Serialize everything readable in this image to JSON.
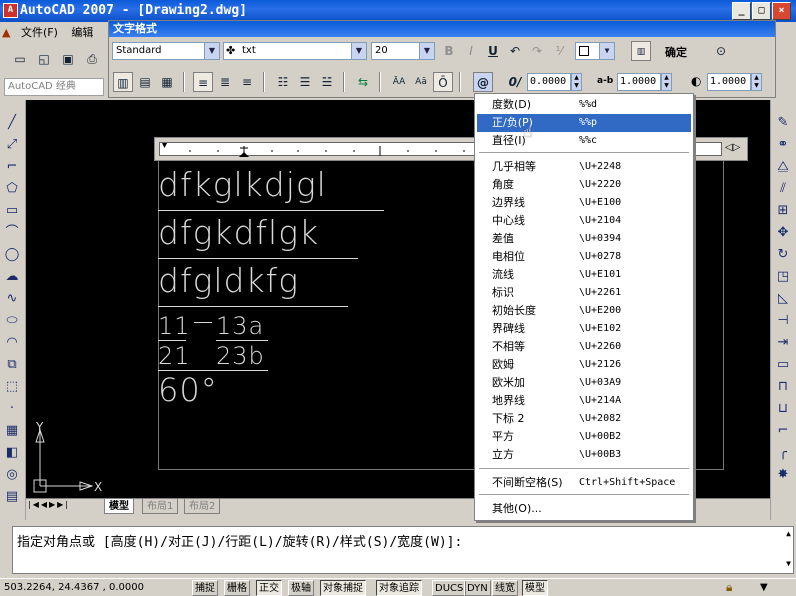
{
  "window": {
    "title": "AutoCAD 2007 - [Drawing2.dwg]",
    "app_icon": "A"
  },
  "menubar": {
    "items": [
      "文件(F)",
      "编辑"
    ]
  },
  "workspace": {
    "label": "AutoCAD 经典"
  },
  "text_format": {
    "title": "文字格式",
    "style": "Standard",
    "font": "txt",
    "height": "20",
    "bold_label": "B",
    "italic_label": "I",
    "underline_label": "U",
    "ok_label": "确定",
    "oblique_value": "0.0000",
    "tracking_value": "1.0000",
    "width_value": "1.0000",
    "tracking_label": "a-b",
    "oblique_label": "0/",
    "at_label": "@"
  },
  "drawing": {
    "lines": [
      "dfkglkdjgl",
      "dfgkdflgk",
      "dfgldkfg"
    ],
    "stack1_top": "11",
    "stack1_bottom": "21",
    "stack2_top": "13a",
    "stack2_bottom": "23b",
    "degree_text": "60°",
    "axis_y": "Y",
    "axis_x": "X"
  },
  "tabs": [
    "模型",
    "布局1",
    "布局2"
  ],
  "command": {
    "prompt": "指定对角点或 [高度(H)/对正(J)/行距(L)/旋转(R)/样式(S)/宽度(W)]:"
  },
  "status": {
    "coords": "503.2264, 24.4367 , 0.0000",
    "buttons": [
      "捕捉",
      "栅格",
      "正交",
      "极轴",
      "对象捕捉",
      "对象追踪",
      "DUCS",
      "DYN",
      "线宽",
      "模型"
    ]
  },
  "symbol_menu": {
    "items": [
      {
        "label": "度数(D)",
        "code": "%%d"
      },
      {
        "label": "正/负(P)",
        "code": "%%p"
      },
      {
        "label": "直径(I)",
        "code": "%%c"
      },
      {
        "label": "几乎相等",
        "code": "\\U+2248"
      },
      {
        "label": "角度",
        "code": "\\U+2220"
      },
      {
        "label": "边界线",
        "code": "\\U+E100"
      },
      {
        "label": "中心线",
        "code": "\\U+2104"
      },
      {
        "label": "差值",
        "code": "\\U+0394"
      },
      {
        "label": "电相位",
        "code": "\\U+0278"
      },
      {
        "label": "流线",
        "code": "\\U+E101"
      },
      {
        "label": "标识",
        "code": "\\U+2261"
      },
      {
        "label": "初始长度",
        "code": "\\U+E200"
      },
      {
        "label": "界碑线",
        "code": "\\U+E102"
      },
      {
        "label": "不相等",
        "code": "\\U+2260"
      },
      {
        "label": "欧姆",
        "code": "\\U+2126"
      },
      {
        "label": "欧米加",
        "code": "\\U+03A9"
      },
      {
        "label": "地界线",
        "code": "\\U+214A"
      },
      {
        "label": "下标 2",
        "code": "\\U+2082"
      },
      {
        "label": "平方",
        "code": "\\U+00B2"
      },
      {
        "label": "立方",
        "code": "\\U+00B3"
      },
      {
        "label": "不间断空格(S)",
        "code": "Ctrl+Shift+Space"
      },
      {
        "label": "其他(O)...",
        "code": ""
      }
    ]
  }
}
